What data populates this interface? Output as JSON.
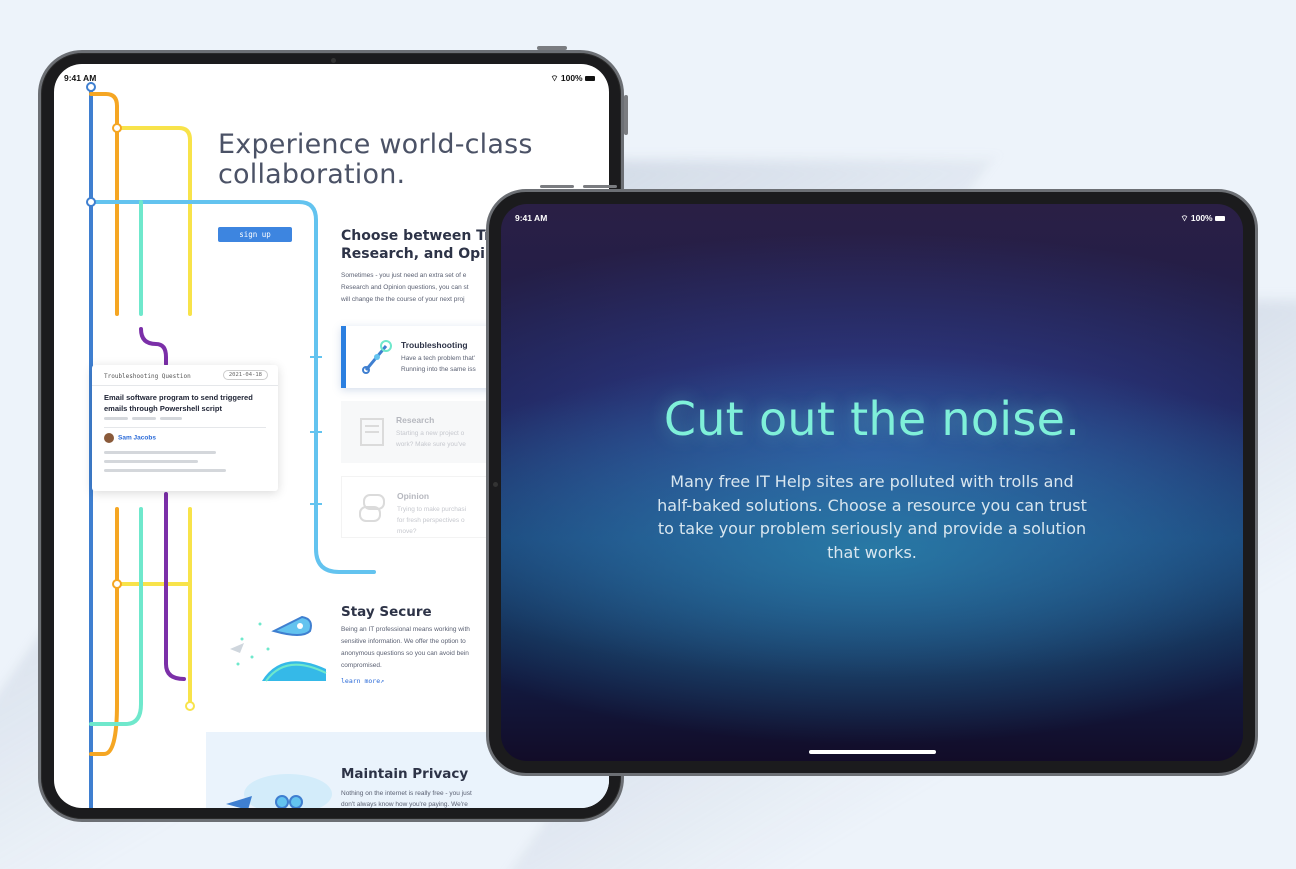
{
  "left_device": {
    "status": {
      "time": "9:41 AM",
      "battery": "100%"
    },
    "hero": {
      "title_line1": "Experience world-class",
      "title_line2": "collaboration.",
      "signup_label": "sign up"
    },
    "choose": {
      "title_line1": "Choose between Troub",
      "title_line2": "Research, and Opinio",
      "desc_line1": "Sometimes - you just need an extra set of e",
      "desc_line2": "Research and Opinion questions, you can st",
      "desc_line3": "will change the the course of your next proj"
    },
    "cards": [
      {
        "title": "Troubleshooting",
        "desc_line1": "Have a tech problem that'",
        "desc_line2": "Running into the same iss"
      },
      {
        "title": "Research",
        "desc_line1": "Starting a new project o",
        "desc_line2": "work? Make sure you've"
      },
      {
        "title": "Opinion",
        "desc_line1": "Trying to make purchasi",
        "desc_line2": "for fresh perspectives o",
        "desc_line3": "move?"
      }
    ],
    "question_card": {
      "type": "Troubleshooting Question",
      "date": "2021-04-18",
      "title": "Email software program to send triggered emails through Powershell script",
      "author": "Sam Jacobs"
    },
    "secure": {
      "title": "Stay Secure",
      "desc_line1": "Being an IT professional means working with",
      "desc_line2": "sensitive information. We offer the option to",
      "desc_line3": "anonymous questions so you can avoid bein",
      "desc_line4": "compromised.",
      "link": "learn more↗"
    },
    "privacy": {
      "title": "Maintain Privacy",
      "desc_line1": "Nothing on the internet is really free - you just",
      "desc_line2": "don't always know how you're paying. We're"
    }
  },
  "right_device": {
    "status": {
      "time": "9:41 AM",
      "battery": "100%"
    },
    "title": "Cut out the noise.",
    "description": "Many free IT Help sites are polluted with trolls and half-baked solutions. Choose a resource you can trust to take your problem seriously and provide a solution that works."
  },
  "colors": {
    "background": "#edf3fa",
    "accent_blue": "#3d85e0",
    "headline_mint": "#7ff0d9",
    "line_blue": "#3f7fd0",
    "line_orange": "#f5a623",
    "line_yellow": "#f8e34a",
    "line_sky": "#63c3ef",
    "line_teal": "#6fe8cc",
    "line_purple": "#7b2fa8"
  }
}
